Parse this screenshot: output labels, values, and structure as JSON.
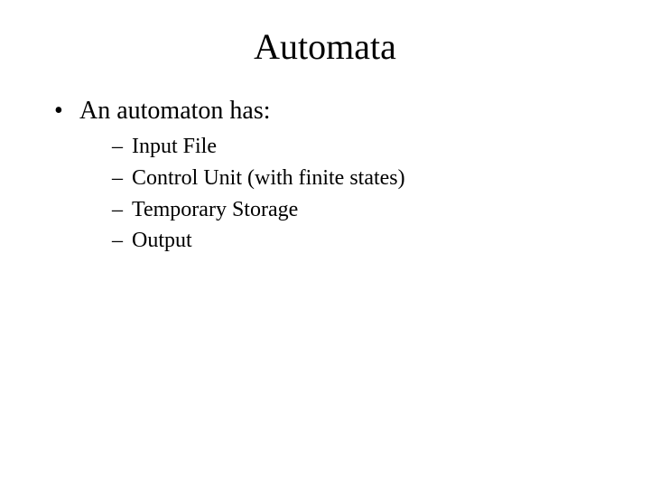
{
  "slide": {
    "title": "Automata",
    "bullet": "An automaton has:",
    "subitems": [
      "Input File",
      "Control Unit (with finite states)",
      "Temporary Storage",
      "Output"
    ]
  }
}
